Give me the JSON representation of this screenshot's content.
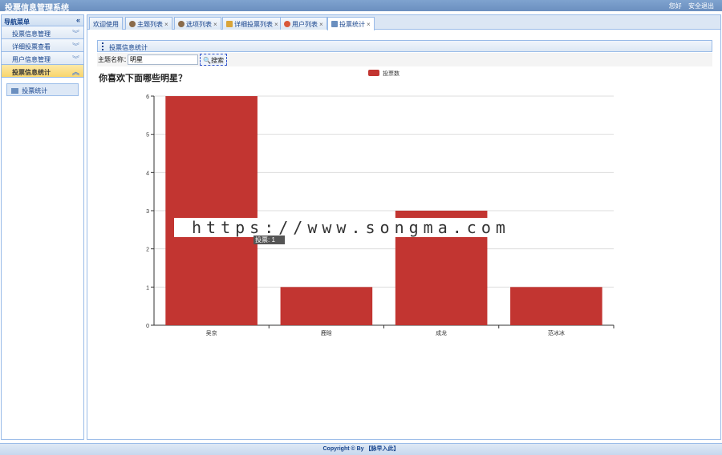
{
  "app": {
    "title": "投票信息管理系统",
    "user_link": "您好",
    "logout": "安全退出"
  },
  "sidebar": {
    "header": "导航菜单",
    "items": [
      {
        "label": "投票信息管理",
        "active": false
      },
      {
        "label": "详细投票查看",
        "active": false
      },
      {
        "label": "用户信息管理",
        "active": false
      },
      {
        "label": "投票信息统计",
        "active": true
      }
    ],
    "sub_item": "投票统计"
  },
  "tabs": [
    {
      "label": "欢迎使用",
      "closable": false
    },
    {
      "label": "主题列表",
      "closable": true
    },
    {
      "label": "选项列表",
      "closable": true
    },
    {
      "label": "详细投票列表",
      "closable": true
    },
    {
      "label": "用户列表",
      "closable": true
    },
    {
      "label": "投票统计",
      "closable": true,
      "active": true
    }
  ],
  "panel": {
    "title": "投票信息统计"
  },
  "search": {
    "label": "主题名称：",
    "value": "明星",
    "button": "搜索"
  },
  "chart_data": {
    "type": "bar",
    "title": "你喜欢下面哪些明星？",
    "categories": [
      "吴京",
      "鹿晗",
      "成龙",
      "范冰冰"
    ],
    "series": [
      {
        "name": "投票数",
        "values": [
          6,
          1,
          3,
          1
        ],
        "color": "#c23531"
      }
    ],
    "ylim": [
      0,
      6
    ],
    "yticks": [
      0,
      1,
      2,
      3,
      4,
      5,
      6
    ],
    "grid": true,
    "legend": "top-center"
  },
  "tooltip": "投票: 1",
  "watermark": "https://www.songma.com",
  "footer": "Copyright © By 【脉早入此】"
}
